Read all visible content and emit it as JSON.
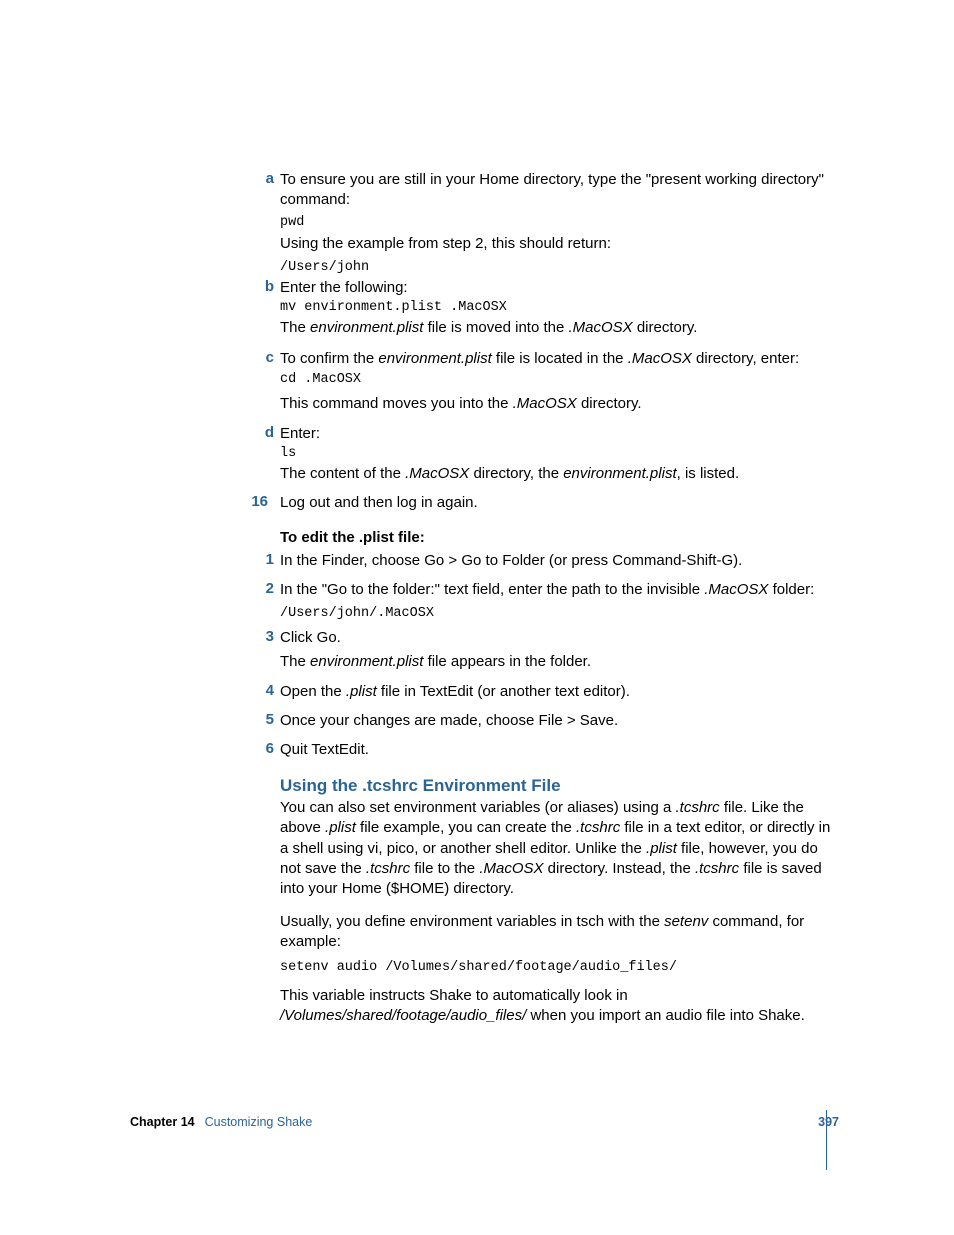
{
  "steps": {
    "a": {
      "marker": "a",
      "line1": "To ensure you are still in your Home directory, type the \"present working directory\" command:",
      "code1": "pwd",
      "line2": "Using the example from step 2, this should return:",
      "code2": "/Users/john"
    },
    "b": {
      "marker": "b",
      "line1": "Enter the following:",
      "code1": "mv environment.plist .MacOSX",
      "line2a": "The ",
      "line2b": "environment.plist",
      "line2c": " file is moved into the ",
      "line2d": ".MacOSX",
      "line2e": " directory."
    },
    "c": {
      "marker": "c",
      "line1a": "To confirm the ",
      "line1b": "environment.plist",
      "line1c": " file is located in the ",
      "line1d": ".MacOSX",
      "line1e": " directory, enter:",
      "code1": "cd .MacOSX",
      "line2a": "This command moves you into the ",
      "line2b": ".MacOSX",
      "line2c": " directory."
    },
    "d": {
      "marker": "d",
      "line1": "Enter:",
      "code1": "ls",
      "line2a": "The content of the ",
      "line2b": ".MacOSX",
      "line2c": " directory, the ",
      "line2d": "environment.plist",
      "line2e": ", is listed."
    }
  },
  "step16": {
    "marker": "16",
    "text": "Log out and then log in again."
  },
  "edit_title": "To edit the .plist file:",
  "edit": {
    "s1": {
      "marker": "1",
      "text": "In the Finder, choose Go > Go to Folder (or press Command-Shift-G)."
    },
    "s2": {
      "marker": "2",
      "text_a": "In the \"Go to the folder:\" text field, enter the path to the invisible ",
      "text_b": ".MacOSX",
      "text_c": " folder:",
      "code": "/Users/john/.MacOSX"
    },
    "s3": {
      "marker": "3",
      "line1": "Click Go.",
      "line2a": "The ",
      "line2b": "environment.plist",
      "line2c": " file appears in the folder."
    },
    "s4": {
      "marker": "4",
      "text_a": "Open the ",
      "text_b": ".plist",
      "text_c": " file in TextEdit (or another text editor)."
    },
    "s5": {
      "marker": "5",
      "text": "Once your changes are made, choose File > Save."
    },
    "s6": {
      "marker": "6",
      "text": "Quit TextEdit."
    }
  },
  "tcshrc": {
    "heading": "Using the .tcshrc Environment File",
    "p1_a": "You can also set environment variables (or aliases) using a ",
    "p1_b": ".tcshrc",
    "p1_c": " file. Like the above ",
    "p1_d": ".plist",
    "p1_e": " file example, you can create the ",
    "p1_f": ".tcshrc",
    "p1_g": " file in a text editor, or directly in a shell using vi, pico, or another shell editor. Unlike the ",
    "p1_h": ".plist",
    "p1_i": " file, however, you do not save the ",
    "p1_j": ".tcshrc",
    "p1_k": " file to the ",
    "p1_l": ".MacOSX",
    "p1_m": " directory. Instead, the ",
    "p1_n": ".tcshrc",
    "p1_o": " file is saved into your Home ($HOME) directory.",
    "p2_a": "Usually, you define environment variables in tsch with the ",
    "p2_b": "setenv",
    "p2_c": " command, for example:",
    "code": "setenv audio /Volumes/shared/footage/audio_files/",
    "p3_a": "This variable instructs Shake to automatically look in ",
    "p3_b": "/Volumes/shared/footage/audio_files/",
    "p3_c": " when you import an audio file into Shake."
  },
  "footer": {
    "chapter_label": "Chapter 14",
    "chapter_title": "Customizing Shake",
    "page_number": "397"
  }
}
